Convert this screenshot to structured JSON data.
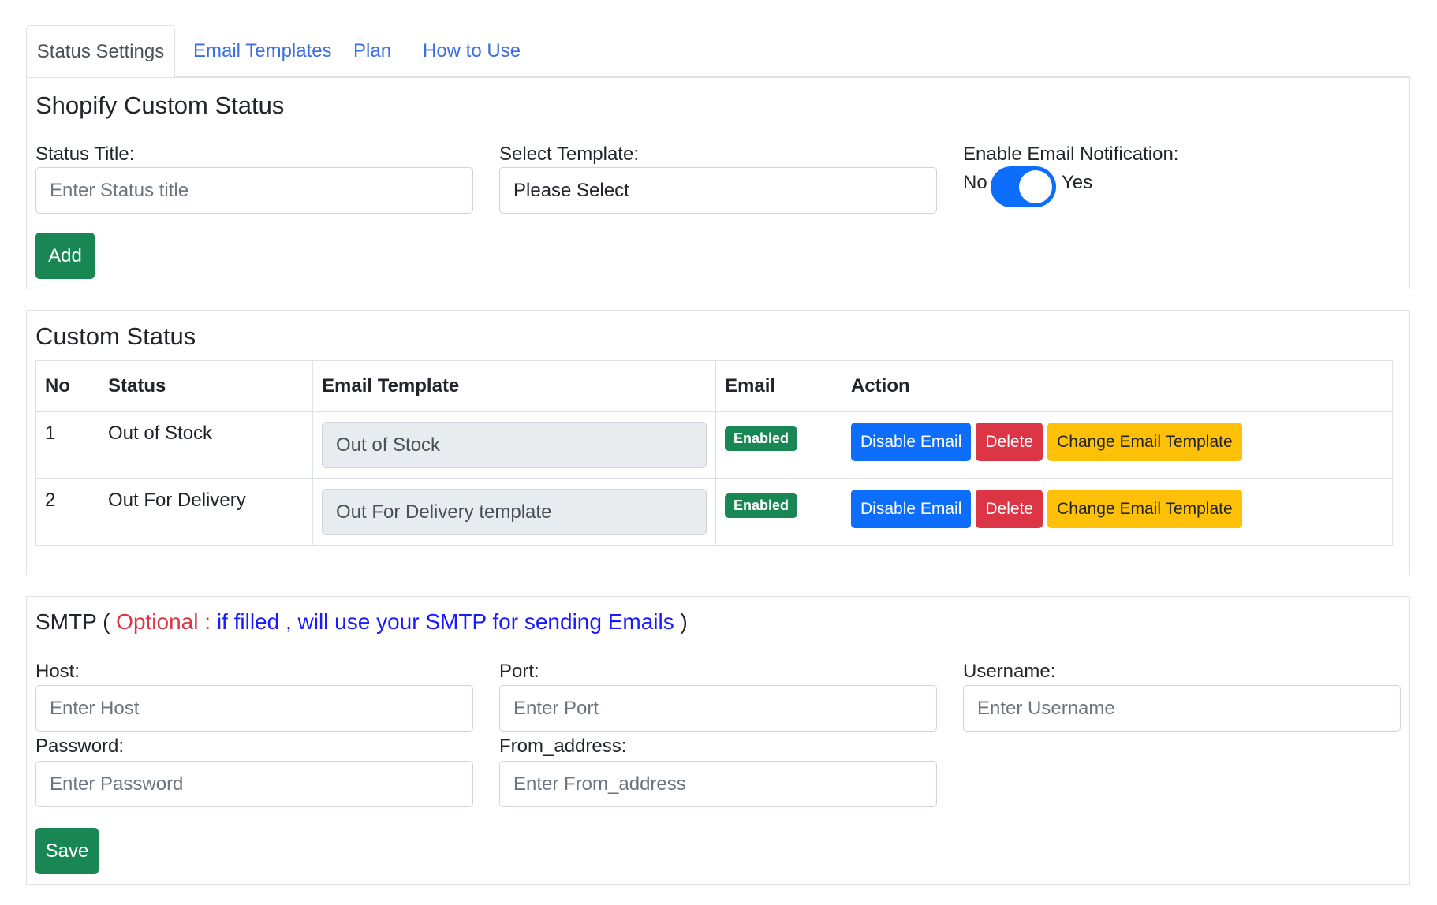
{
  "tabs": [
    {
      "label": "Status Settings"
    },
    {
      "label": "Email Templates"
    },
    {
      "label": "Plan"
    },
    {
      "label": "How to Use"
    }
  ],
  "shopify": {
    "title": "Shopify Custom Status",
    "status_title_label": "Status Title:",
    "status_title_placeholder": "Enter Status title",
    "select_template_label": "Select Template:",
    "select_template_value": "Please Select",
    "email_notification_label": "Enable Email Notification:",
    "toggle_no": "No",
    "toggle_yes": "Yes",
    "toggle_on": true,
    "add_button": "Add"
  },
  "custom_status": {
    "title": "Custom Status",
    "headers": [
      "No",
      "Status",
      "Email Template",
      "Email",
      "Action"
    ],
    "rows": [
      {
        "no": "1",
        "status": "Out of Stock",
        "template": "Out of Stock",
        "email": "Enabled"
      },
      {
        "no": "2",
        "status": "Out For Delivery",
        "template": "Out For Delivery template",
        "email": "Enabled"
      }
    ],
    "actions": {
      "disable": "Disable Email",
      "delete": "Delete",
      "change": "Change Email Template"
    }
  },
  "smtp": {
    "title": "SMTP",
    "open_paren": "(",
    "optional": "Optional :",
    "note": "if filled , will use your SMTP for sending Emails",
    "close_paren": ")",
    "host_label": "Host:",
    "host_placeholder": "Enter Host",
    "port_label": "Port:",
    "port_placeholder": "Enter Port",
    "username_label": "Username:",
    "username_placeholder": "Enter Username",
    "password_label": "Password:",
    "password_placeholder": "Enter Password",
    "from_label": "From_address:",
    "from_placeholder": "Enter From_address",
    "save_button": "Save"
  },
  "colors": {
    "primary": "#0d6efd",
    "success": "#198754",
    "danger": "#dc3545",
    "warning": "#ffc107",
    "link": "#3b6fe0"
  }
}
